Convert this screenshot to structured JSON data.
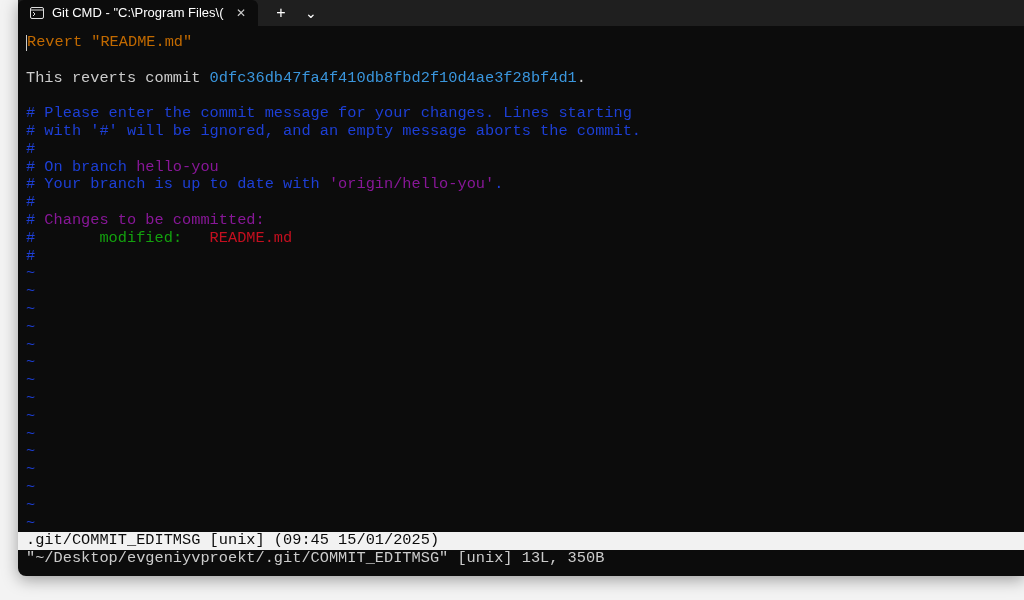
{
  "tab": {
    "title": "Git CMD - \"C:\\Program Files\\(",
    "close": "✕",
    "new_tab": "+",
    "menu": "⌄"
  },
  "lines": [
    [
      {
        "text": "Revert \"README.md\"",
        "kind": "title"
      }
    ],
    [
      {
        "kind": "blank"
      }
    ],
    [
      {
        "text": "This reverts commit ",
        "kind": "plain"
      },
      {
        "text": "0dfc36db47fa4f410db8fbd2f10d4ae3f28bf4d1",
        "kind": "hash"
      },
      {
        "text": ".",
        "kind": "plain"
      }
    ],
    [
      {
        "kind": "blank"
      }
    ],
    [
      {
        "text": "# Please enter the commit message for your changes. Lines starting",
        "kind": "comment"
      }
    ],
    [
      {
        "text": "# with '#' will be ignored, and an empty message aborts the commit.",
        "kind": "comment"
      }
    ],
    [
      {
        "text": "#",
        "kind": "comment"
      }
    ],
    [
      {
        "text": "# On branch ",
        "kind": "comment"
      },
      {
        "text": "hello-you",
        "kind": "branch"
      }
    ],
    [
      {
        "text": "# Your branch is up to date with ",
        "kind": "comment"
      },
      {
        "text": "'origin/hello-you'",
        "kind": "branch"
      },
      {
        "text": ".",
        "kind": "comment"
      }
    ],
    [
      {
        "text": "#",
        "kind": "comment"
      }
    ],
    [
      {
        "text": "# ",
        "kind": "comment"
      },
      {
        "text": "Changes to be committed:",
        "kind": "branch"
      }
    ],
    [
      {
        "text": "#",
        "kind": "comment"
      },
      {
        "text": "       modified:",
        "kind": "added"
      },
      {
        "text": "   README.md",
        "kind": "file"
      }
    ],
    [
      {
        "text": "#",
        "kind": "comment"
      }
    ],
    [
      {
        "text": "~",
        "kind": "comment"
      }
    ],
    [
      {
        "text": "~",
        "kind": "comment"
      }
    ],
    [
      {
        "text": "~",
        "kind": "comment"
      }
    ],
    [
      {
        "text": "~",
        "kind": "comment"
      }
    ],
    [
      {
        "text": "~",
        "kind": "comment"
      }
    ],
    [
      {
        "text": "~",
        "kind": "comment"
      }
    ],
    [
      {
        "text": "~",
        "kind": "comment"
      }
    ],
    [
      {
        "text": "~",
        "kind": "comment"
      }
    ],
    [
      {
        "text": "~",
        "kind": "comment"
      }
    ],
    [
      {
        "text": "~",
        "kind": "comment"
      }
    ],
    [
      {
        "text": "~",
        "kind": "comment"
      }
    ],
    [
      {
        "text": "~",
        "kind": "comment"
      }
    ],
    [
      {
        "text": "~",
        "kind": "comment"
      }
    ],
    [
      {
        "text": "~",
        "kind": "comment"
      }
    ],
    [
      {
        "text": "~",
        "kind": "comment"
      }
    ]
  ],
  "status_line": ".git/COMMIT_EDITMSG [unix] (09:45 15/01/2025)",
  "message": "\"~/Desktop/evgeniyvproekt/.git/COMMIT_EDITMSG\" [unix] 13L, 350B"
}
